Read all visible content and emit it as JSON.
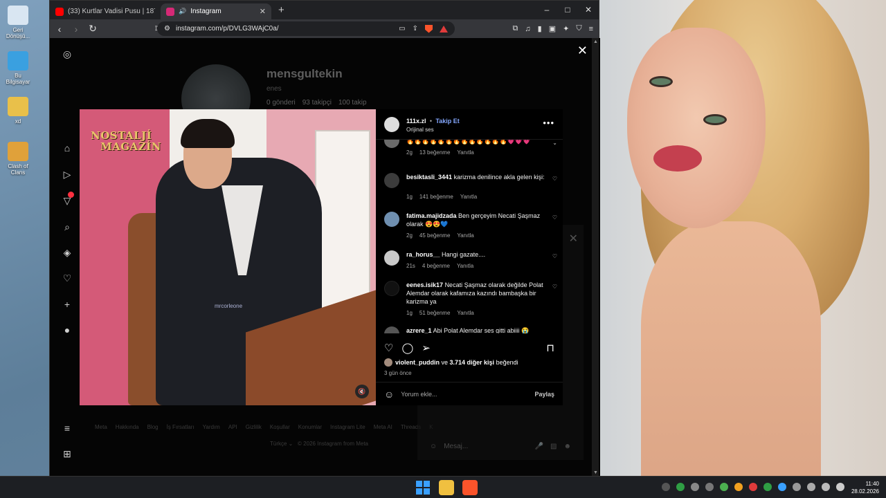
{
  "desktop": {
    "icons": [
      {
        "label": "Geri Dönüşü...",
        "color": "#d9e6f2"
      },
      {
        "label": "Bu Bilgisayar",
        "color": "#3aa0e0"
      },
      {
        "label": "xd",
        "color": "#e9c04a"
      },
      {
        "label": "Clash of Clans",
        "color": "#e0a13a"
      }
    ]
  },
  "browser": {
    "tabs": [
      {
        "title": "(33) Kurtlar Vadisi Pusu | 187. Bölüm",
        "favicon_color": "#ff0000"
      },
      {
        "title": "Instagram",
        "favicon_color": "#d62976"
      }
    ],
    "new_tab": "+",
    "window_controls": {
      "minimize": "–",
      "maximize": "□",
      "close": "✕"
    },
    "url": "instagram.com/p/DVLG3WAjC0a/"
  },
  "profile_bg": {
    "username": "mensgultekin",
    "name": "enes",
    "posts": "0 gönderi",
    "followers": "93 takipçi",
    "following": "100 takip"
  },
  "video": {
    "logo_line1": "NOSTALJİ",
    "logo_line2": "MAGAZİN",
    "watermark": "mrcorleone",
    "mute_icon": "🔇"
  },
  "post": {
    "author": "111x.zl",
    "separator": "•",
    "follow_label": "Takip Et",
    "audio": "Orijinal ses",
    "more": "•••",
    "comments": [
      {
        "user": "",
        "text": "🔥🔥🔥🔥🔥🔥🔥🔥🔥🔥🔥🔥🔥💗💗💗",
        "time": "2g",
        "likes": "13 beğenme",
        "reply": "Yanıtla",
        "avatar_color": "#6b6b6b"
      },
      {
        "user": "besiktasli_3441",
        "text": "karizma denilince akla gelen kişi:",
        "time": "1g",
        "likes": "141 beğenme",
        "reply": "Yanıtla",
        "avatar_color": "#3c3c3c"
      },
      {
        "user": "fatima.majidzada",
        "text": "Ben gerçeyim Necati Şaşmaz olarak 😍😍💙",
        "time": "2g",
        "likes": "45 beğenme",
        "reply": "Yanıtla",
        "avatar_color": "#6f8fb0"
      },
      {
        "user": "ra_horus__",
        "text": "Hangi gazate....",
        "time": "21s",
        "likes": "4 beğenme",
        "reply": "Yanıtla",
        "avatar_color": "#c9c9c9"
      },
      {
        "user": "eenes.isik17",
        "text": "Necati Şaşmaz olarak değilde Polat Alemdar olarak kafamıza kazındı bambaşka bir karizma ya",
        "time": "1g",
        "likes": "51 beğenme",
        "reply": "Yanıtla",
        "avatar_color": "#111111"
      },
      {
        "user": "azrere_1",
        "text": "Abi Polat Alemdar ses gitti abiiii 😭",
        "time": "",
        "likes": "",
        "reply": "",
        "avatar_color": "#555555"
      }
    ],
    "liked_by_user": "violent_puddin",
    "liked_by_mid": " ve ",
    "liked_by_rest": "3.714 diğer kişi",
    "liked_by_suffix": " beğendi",
    "posted_ago": "3 gün önce",
    "comment_placeholder": "Yorum ekle...",
    "post_label": "Paylaş"
  },
  "footer": {
    "links": [
      "Meta",
      "Hakkında",
      "Blog",
      "İş Fırsatları",
      "Yardım",
      "API",
      "Gizlilik",
      "Koşullar",
      "Konumlar",
      "Instagram Lite",
      "Meta AI",
      "Threads",
      "K"
    ],
    "language": "Türkçe ⌄",
    "copyright": "© 2026 Instagram from Meta"
  },
  "messages": {
    "placeholder": "Mesaj..."
  },
  "taskbar": {
    "time": "11:40",
    "date": "28.02.2026"
  }
}
